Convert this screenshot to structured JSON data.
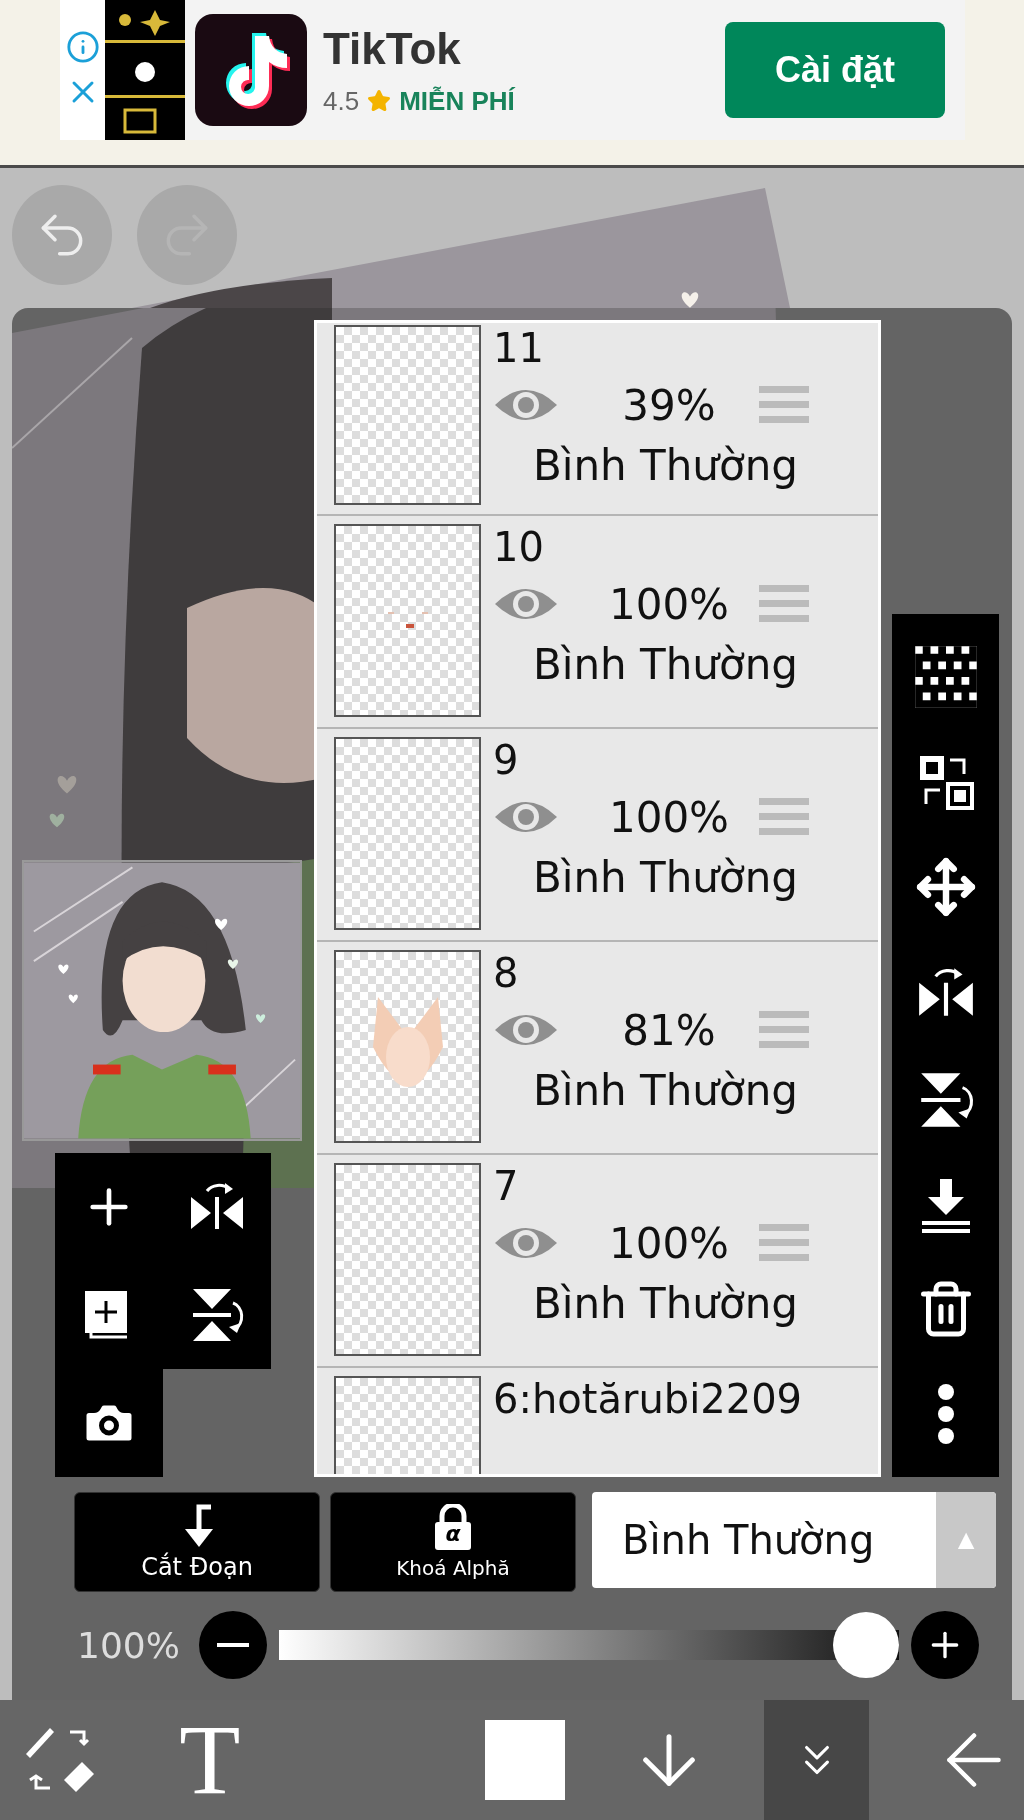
{
  "ad": {
    "title": "TikTok",
    "rating": "4.5",
    "price": "MIỄN PHÍ",
    "button": "Cài đặt"
  },
  "history": [
    {
      "kind": "undo",
      "disabled": false
    },
    {
      "kind": "redo",
      "disabled": true
    }
  ],
  "layers": [
    {
      "name": "11",
      "opacity": "39%",
      "blend": "Bình Thường",
      "visible": true,
      "kind": "blank"
    },
    {
      "name": "10",
      "opacity": "100%",
      "blend": "Bình Thường",
      "visible": true,
      "kind": "marks"
    },
    {
      "name": "9",
      "opacity": "100%",
      "blend": "Bình Thường",
      "visible": true,
      "kind": "blank"
    },
    {
      "name": "8",
      "opacity": "81%",
      "blend": "Bình Thường",
      "visible": true,
      "kind": "skin"
    },
    {
      "name": "7",
      "opacity": "100%",
      "blend": "Bình Thường",
      "visible": true,
      "kind": "blank"
    },
    {
      "name": "6:hotărubi2209",
      "kind": "blank"
    }
  ],
  "left_tools": [
    {
      "kind": "add"
    },
    {
      "kind": "flip_h"
    },
    {
      "kind": "add_copy"
    },
    {
      "kind": "flip_v"
    },
    {
      "kind": "camera"
    }
  ],
  "right_tools": [
    {
      "kind": "transparent"
    },
    {
      "kind": "swap"
    },
    {
      "kind": "move"
    },
    {
      "kind": "flip_h"
    },
    {
      "kind": "flip_v"
    },
    {
      "kind": "merge_down"
    },
    {
      "kind": "trash"
    },
    {
      "kind": "more"
    }
  ],
  "clip_button": {
    "label": "Cắt Đoạn"
  },
  "alpha_lock_button": {
    "label": "Khoá Alphă",
    "glyph": "α"
  },
  "blend_select": {
    "value": "Bình Thường",
    "arrow": "▲"
  },
  "opacity": {
    "reading": "100%",
    "level": 1.0
  },
  "toolbar": [
    {
      "kind": "brush_eraser",
      "selected": false
    },
    {
      "kind": "text",
      "label": "T",
      "selected": false
    },
    {
      "kind": "color",
      "selected": false
    },
    {
      "kind": "down",
      "selected": false
    },
    {
      "kind": "layers",
      "selected": true
    },
    {
      "kind": "back",
      "selected": false
    }
  ]
}
